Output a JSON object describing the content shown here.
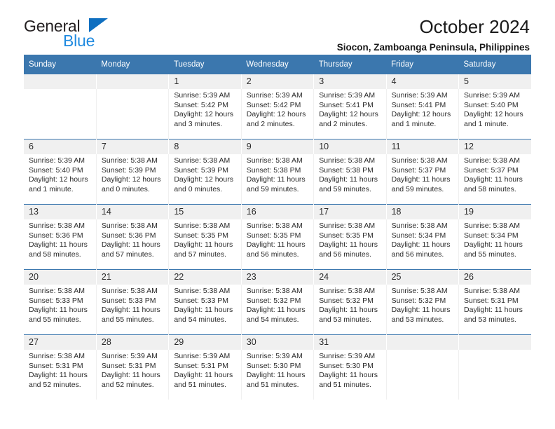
{
  "brand": {
    "name_top": "General",
    "name_bottom": "Blue",
    "triangle_color": "#0f6fc0",
    "blue_text_color": "#1f8ae0"
  },
  "header": {
    "title": "October 2024",
    "location": "Siocon, Zamboanga Peninsula, Philippines"
  },
  "theme": {
    "header_blue": "#3b77ae",
    "date_band": "#f0f0f0",
    "text": "#2b2b2b"
  },
  "calendar": {
    "weekday_headers": [
      "Sunday",
      "Monday",
      "Tuesday",
      "Wednesday",
      "Thursday",
      "Friday",
      "Saturday"
    ],
    "weeks": [
      {
        "days": [
          {
            "date": "",
            "sunrise": "",
            "sunset": "",
            "daylight_1": "",
            "daylight_2": ""
          },
          {
            "date": "",
            "sunrise": "",
            "sunset": "",
            "daylight_1": "",
            "daylight_2": ""
          },
          {
            "date": "1",
            "sunrise": "Sunrise: 5:39 AM",
            "sunset": "Sunset: 5:42 PM",
            "daylight_1": "Daylight: 12 hours",
            "daylight_2": "and 3 minutes."
          },
          {
            "date": "2",
            "sunrise": "Sunrise: 5:39 AM",
            "sunset": "Sunset: 5:42 PM",
            "daylight_1": "Daylight: 12 hours",
            "daylight_2": "and 2 minutes."
          },
          {
            "date": "3",
            "sunrise": "Sunrise: 5:39 AM",
            "sunset": "Sunset: 5:41 PM",
            "daylight_1": "Daylight: 12 hours",
            "daylight_2": "and 2 minutes."
          },
          {
            "date": "4",
            "sunrise": "Sunrise: 5:39 AM",
            "sunset": "Sunset: 5:41 PM",
            "daylight_1": "Daylight: 12 hours",
            "daylight_2": "and 1 minute."
          },
          {
            "date": "5",
            "sunrise": "Sunrise: 5:39 AM",
            "sunset": "Sunset: 5:40 PM",
            "daylight_1": "Daylight: 12 hours",
            "daylight_2": "and 1 minute."
          }
        ]
      },
      {
        "days": [
          {
            "date": "6",
            "sunrise": "Sunrise: 5:39 AM",
            "sunset": "Sunset: 5:40 PM",
            "daylight_1": "Daylight: 12 hours",
            "daylight_2": "and 1 minute."
          },
          {
            "date": "7",
            "sunrise": "Sunrise: 5:38 AM",
            "sunset": "Sunset: 5:39 PM",
            "daylight_1": "Daylight: 12 hours",
            "daylight_2": "and 0 minutes."
          },
          {
            "date": "8",
            "sunrise": "Sunrise: 5:38 AM",
            "sunset": "Sunset: 5:39 PM",
            "daylight_1": "Daylight: 12 hours",
            "daylight_2": "and 0 minutes."
          },
          {
            "date": "9",
            "sunrise": "Sunrise: 5:38 AM",
            "sunset": "Sunset: 5:38 PM",
            "daylight_1": "Daylight: 11 hours",
            "daylight_2": "and 59 minutes."
          },
          {
            "date": "10",
            "sunrise": "Sunrise: 5:38 AM",
            "sunset": "Sunset: 5:38 PM",
            "daylight_1": "Daylight: 11 hours",
            "daylight_2": "and 59 minutes."
          },
          {
            "date": "11",
            "sunrise": "Sunrise: 5:38 AM",
            "sunset": "Sunset: 5:37 PM",
            "daylight_1": "Daylight: 11 hours",
            "daylight_2": "and 59 minutes."
          },
          {
            "date": "12",
            "sunrise": "Sunrise: 5:38 AM",
            "sunset": "Sunset: 5:37 PM",
            "daylight_1": "Daylight: 11 hours",
            "daylight_2": "and 58 minutes."
          }
        ]
      },
      {
        "days": [
          {
            "date": "13",
            "sunrise": "Sunrise: 5:38 AM",
            "sunset": "Sunset: 5:36 PM",
            "daylight_1": "Daylight: 11 hours",
            "daylight_2": "and 58 minutes."
          },
          {
            "date": "14",
            "sunrise": "Sunrise: 5:38 AM",
            "sunset": "Sunset: 5:36 PM",
            "daylight_1": "Daylight: 11 hours",
            "daylight_2": "and 57 minutes."
          },
          {
            "date": "15",
            "sunrise": "Sunrise: 5:38 AM",
            "sunset": "Sunset: 5:35 PM",
            "daylight_1": "Daylight: 11 hours",
            "daylight_2": "and 57 minutes."
          },
          {
            "date": "16",
            "sunrise": "Sunrise: 5:38 AM",
            "sunset": "Sunset: 5:35 PM",
            "daylight_1": "Daylight: 11 hours",
            "daylight_2": "and 56 minutes."
          },
          {
            "date": "17",
            "sunrise": "Sunrise: 5:38 AM",
            "sunset": "Sunset: 5:35 PM",
            "daylight_1": "Daylight: 11 hours",
            "daylight_2": "and 56 minutes."
          },
          {
            "date": "18",
            "sunrise": "Sunrise: 5:38 AM",
            "sunset": "Sunset: 5:34 PM",
            "daylight_1": "Daylight: 11 hours",
            "daylight_2": "and 56 minutes."
          },
          {
            "date": "19",
            "sunrise": "Sunrise: 5:38 AM",
            "sunset": "Sunset: 5:34 PM",
            "daylight_1": "Daylight: 11 hours",
            "daylight_2": "and 55 minutes."
          }
        ]
      },
      {
        "days": [
          {
            "date": "20",
            "sunrise": "Sunrise: 5:38 AM",
            "sunset": "Sunset: 5:33 PM",
            "daylight_1": "Daylight: 11 hours",
            "daylight_2": "and 55 minutes."
          },
          {
            "date": "21",
            "sunrise": "Sunrise: 5:38 AM",
            "sunset": "Sunset: 5:33 PM",
            "daylight_1": "Daylight: 11 hours",
            "daylight_2": "and 55 minutes."
          },
          {
            "date": "22",
            "sunrise": "Sunrise: 5:38 AM",
            "sunset": "Sunset: 5:33 PM",
            "daylight_1": "Daylight: 11 hours",
            "daylight_2": "and 54 minutes."
          },
          {
            "date": "23",
            "sunrise": "Sunrise: 5:38 AM",
            "sunset": "Sunset: 5:32 PM",
            "daylight_1": "Daylight: 11 hours",
            "daylight_2": "and 54 minutes."
          },
          {
            "date": "24",
            "sunrise": "Sunrise: 5:38 AM",
            "sunset": "Sunset: 5:32 PM",
            "daylight_1": "Daylight: 11 hours",
            "daylight_2": "and 53 minutes."
          },
          {
            "date": "25",
            "sunrise": "Sunrise: 5:38 AM",
            "sunset": "Sunset: 5:32 PM",
            "daylight_1": "Daylight: 11 hours",
            "daylight_2": "and 53 minutes."
          },
          {
            "date": "26",
            "sunrise": "Sunrise: 5:38 AM",
            "sunset": "Sunset: 5:31 PM",
            "daylight_1": "Daylight: 11 hours",
            "daylight_2": "and 53 minutes."
          }
        ]
      },
      {
        "days": [
          {
            "date": "27",
            "sunrise": "Sunrise: 5:38 AM",
            "sunset": "Sunset: 5:31 PM",
            "daylight_1": "Daylight: 11 hours",
            "daylight_2": "and 52 minutes."
          },
          {
            "date": "28",
            "sunrise": "Sunrise: 5:39 AM",
            "sunset": "Sunset: 5:31 PM",
            "daylight_1": "Daylight: 11 hours",
            "daylight_2": "and 52 minutes."
          },
          {
            "date": "29",
            "sunrise": "Sunrise: 5:39 AM",
            "sunset": "Sunset: 5:31 PM",
            "daylight_1": "Daylight: 11 hours",
            "daylight_2": "and 51 minutes."
          },
          {
            "date": "30",
            "sunrise": "Sunrise: 5:39 AM",
            "sunset": "Sunset: 5:30 PM",
            "daylight_1": "Daylight: 11 hours",
            "daylight_2": "and 51 minutes."
          },
          {
            "date": "31",
            "sunrise": "Sunrise: 5:39 AM",
            "sunset": "Sunset: 5:30 PM",
            "daylight_1": "Daylight: 11 hours",
            "daylight_2": "and 51 minutes."
          },
          {
            "date": "",
            "sunrise": "",
            "sunset": "",
            "daylight_1": "",
            "daylight_2": ""
          },
          {
            "date": "",
            "sunrise": "",
            "sunset": "",
            "daylight_1": "",
            "daylight_2": ""
          }
        ]
      }
    ]
  }
}
